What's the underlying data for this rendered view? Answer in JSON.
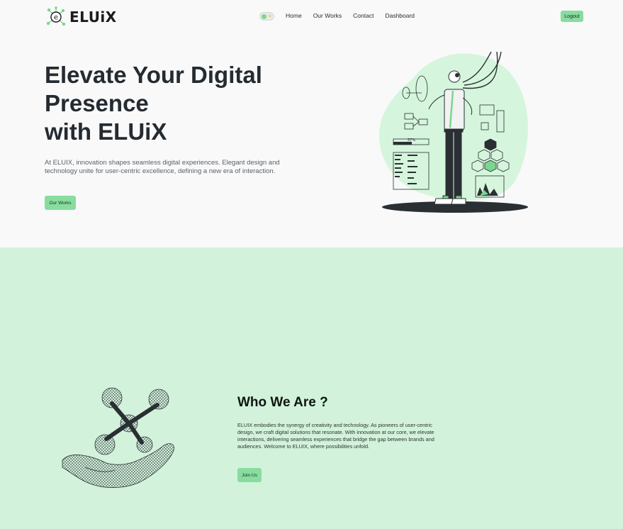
{
  "brand": {
    "name": "ELUiX",
    "logo_letter": "e"
  },
  "nav": {
    "links": [
      "Home",
      "Our Works",
      "Contact",
      "Dashboard"
    ],
    "logout_label": "Logout",
    "theme_toggle_icon": "sun-icon"
  },
  "hero": {
    "title_lines": [
      "Elevate Your Digital",
      "Presence",
      "with ELUiX"
    ],
    "description": "At ELUIX, innovation shapes seamless digital experiences. Elegant design and technology unite for user-centric excellence, defining a new era of interaction.",
    "button_label": "Our Works",
    "illustration_progress_label": "57%"
  },
  "about": {
    "title": "Who We Are ?",
    "description": "ELUIX embodies the synergy of creativity and technology. As pioneers of user-centric design, we craft digital solutions that resonate. With innovation at our core, we elevate interactions, delivering seamless experiences that bridge the gap between brands and audiences. Welcome to ELUIX, where possibilities unfold.",
    "button_label": "Join Us"
  },
  "colors": {
    "accent": "#88dca0",
    "section_bg": "#d2f2db",
    "page_bg": "#f9f9f9",
    "heading": "#242b31"
  }
}
